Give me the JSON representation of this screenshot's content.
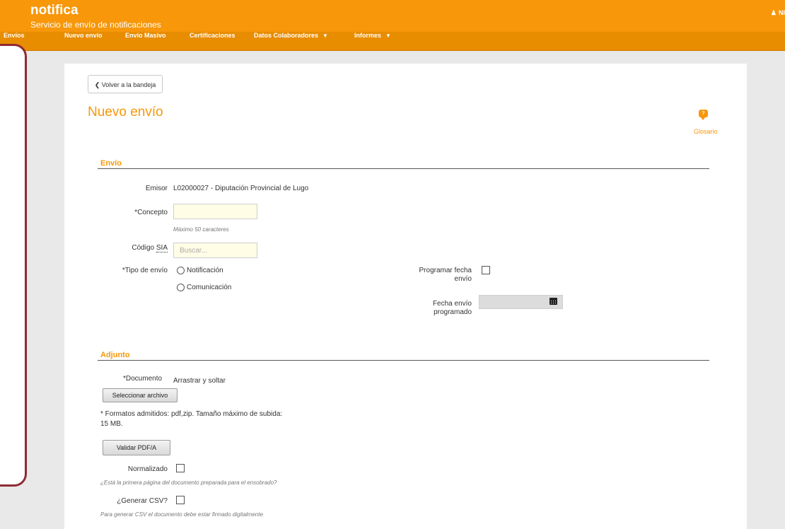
{
  "header": {
    "app_name": "notifica",
    "subtitle": "Servicio de envío de notificaciones",
    "user_initials": "NI",
    "brand_color": "#f79709"
  },
  "nav": {
    "items": [
      {
        "label": "Envíos"
      },
      {
        "label": "Nuevo envío"
      },
      {
        "label": "Envío Masivo"
      },
      {
        "label": "Certificaciones"
      },
      {
        "label": "Datos Colaboradores",
        "dropdown": true
      },
      {
        "label": "Informes",
        "dropdown": true
      }
    ]
  },
  "page": {
    "back_label": "Volver a la bandeja",
    "title": "Nuevo envío",
    "glossary_label": "Glosario"
  },
  "envio": {
    "section_title": "Envío",
    "emisor_label": "Emisor",
    "emisor_value": "L02000027 - Diputación Provincial de Lugo",
    "concepto_label": "*Concepto",
    "concepto_value": "",
    "concepto_hint": "Máximo 50 caracteres",
    "codigo_label_prefix": "Código",
    "codigo_label_abbr": "SIA",
    "codigo_placeholder": "Buscar...",
    "tipo_label": "*Tipo de envío",
    "tipo_options": [
      {
        "label": "Notificación",
        "selected": false
      },
      {
        "label": "Comunicación",
        "selected": false
      }
    ],
    "programar_label_line1": "Programar fecha",
    "programar_label_line2": "envío",
    "programar_checked": false,
    "fecha_label_line1": "Fecha envío",
    "fecha_label_line2": "programado",
    "fecha_value": ""
  },
  "adjunto": {
    "section_title": "Adjunto",
    "documento_label": "*Documento",
    "documento_drop_text": "Arrastrar y soltar",
    "select_button": "Seleccionar archivo",
    "formats_line1": "* Formatos admitidos: pdf,zip. Tamaño máximo de subida:",
    "formats_line2": "15 MB.",
    "validate_button": "Validar PDF/A",
    "normalizado_label": "Normalizado",
    "normalizado_checked": false,
    "normalizado_hint": "¿Está la primera página del documento preparada para el ensobrado?",
    "csv_label": "¿Generar CSV?",
    "csv_checked": false,
    "csv_hint": "Para generar CSV el documento debe estar firmado digitalmente"
  }
}
